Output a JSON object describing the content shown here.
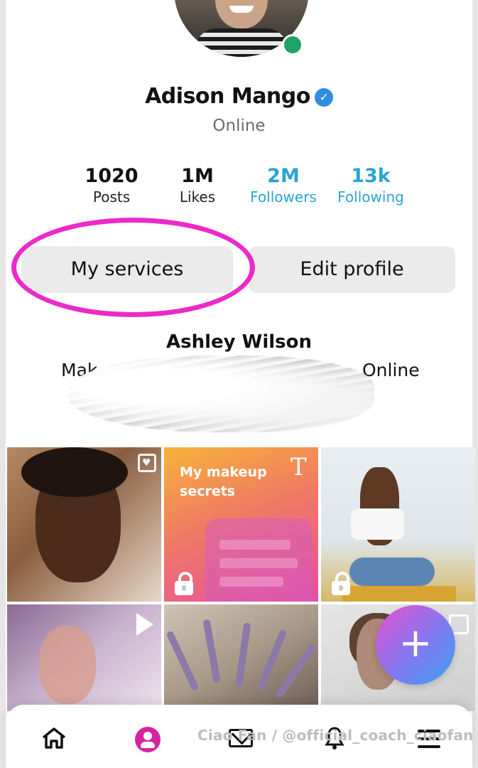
{
  "profile": {
    "name": "Adison Mango",
    "status": "Online"
  },
  "stats": [
    {
      "value": "1020",
      "label": "Posts"
    },
    {
      "value": "1M",
      "label": "Likes"
    },
    {
      "value": "2M",
      "label": "Followers"
    },
    {
      "value": "13k",
      "label": "Following"
    }
  ],
  "actions": {
    "services_label": "My services",
    "edit_label": "Edit profile"
  },
  "card": {
    "name": "Ashley Wilson",
    "sub_visible": "Mak",
    "status": "Online"
  },
  "grid": {
    "tile2_caption": "My makeup secrets",
    "tile2_type_icon": "T"
  },
  "fab": {
    "label": "+"
  },
  "watermark": "Ciao Fan / @official_coach_ciaofan",
  "colors": {
    "accent_link": "#2ba4d4",
    "verified": "#2f8ee0",
    "online": "#1fa36a",
    "highlight": "#ec2ac9",
    "profile_active": "#d6249e"
  },
  "icons": [
    "verified-badge-icon",
    "online-indicator-icon",
    "calendar-heart-icon",
    "text-post-icon",
    "lock-icon",
    "play-icon",
    "gallery-icon",
    "plus-icon",
    "home-icon",
    "profile-icon",
    "mail-icon",
    "bell-icon",
    "menu-icon"
  ]
}
